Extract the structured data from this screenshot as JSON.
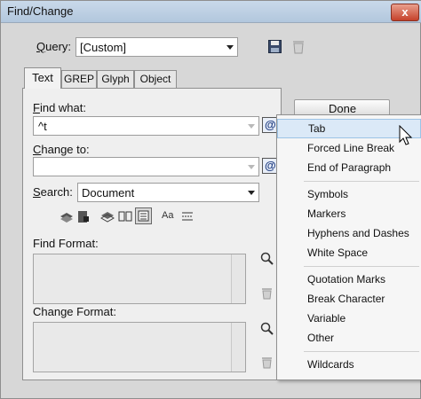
{
  "window": {
    "title": "Find/Change",
    "close_glyph": "x"
  },
  "query": {
    "label": "Query:",
    "value": "[Custom]"
  },
  "tabs": [
    {
      "label": "Text",
      "active": true
    },
    {
      "label": "GREP",
      "active": false
    },
    {
      "label": "Glyph",
      "active": false
    },
    {
      "label": "Object",
      "active": false
    }
  ],
  "find_what": {
    "label": "Find what:",
    "value": "^t"
  },
  "change_to": {
    "label": "Change to:",
    "value": ""
  },
  "search": {
    "label": "Search:",
    "value": "Document"
  },
  "find_format": {
    "label": "Find Format:"
  },
  "change_format": {
    "label": "Change Format:"
  },
  "done_button": {
    "label": "Done"
  },
  "special_char_menu": {
    "items": [
      "Tab",
      "Forced Line Break",
      "End of Paragraph",
      "Symbols",
      "Markers",
      "Hyphens and Dashes",
      "White Space",
      "Quotation Marks",
      "Break Character",
      "Variable",
      "Other",
      "Wildcards"
    ],
    "highlighted": "Tab"
  },
  "icons": {
    "save_query": "floppy-disk-icon",
    "delete_query": "trash-icon",
    "special_chars": "at-sign-icon",
    "format_pointer": "pointer-icon",
    "options": [
      "locked-layers-icon",
      "locked-stories-icon",
      "hidden-layers-icon",
      "master-pages-icon",
      "footnotes-icon",
      "case-sensitive-icon",
      "whole-word-icon"
    ]
  },
  "colors": {
    "title_bar": "#c9d9ea",
    "close_button": "#c5412a",
    "menu_highlight": "#dbe9f7"
  }
}
